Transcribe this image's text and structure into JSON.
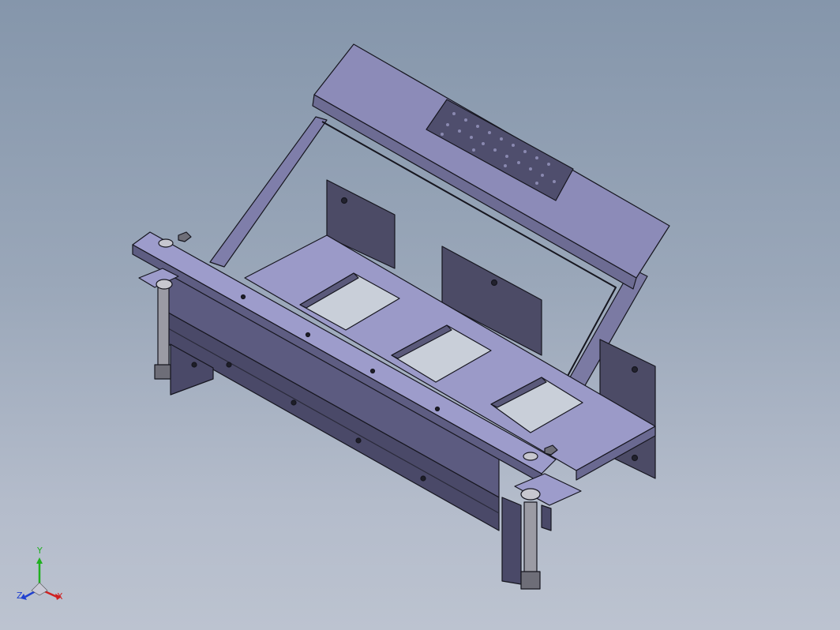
{
  "triad": {
    "x_label": "X",
    "y_label": "Y",
    "z_label": "Z",
    "x_color": "#d02020",
    "y_color": "#20b020",
    "z_color": "#2040d0"
  },
  "model": {
    "body_color": "#8c8ab8",
    "shadow_color": "#4a4a66",
    "edge_color": "#15151f"
  }
}
